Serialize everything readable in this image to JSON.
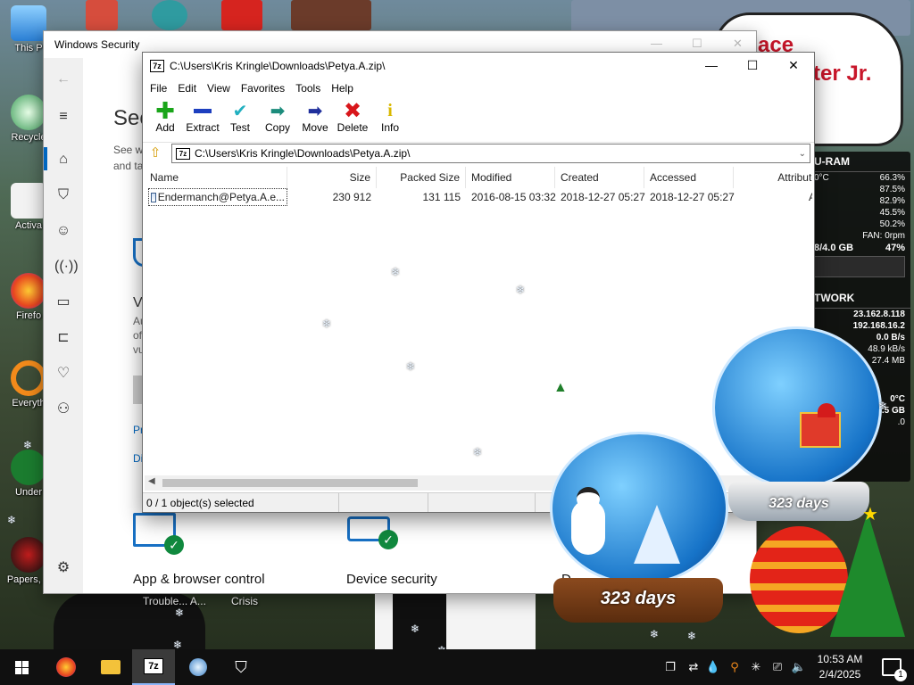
{
  "desktop": {
    "icons": [
      {
        "label": "This P"
      },
      {
        "label": "Recycle"
      },
      {
        "label": "Activa"
      },
      {
        "label": "Firefo"
      },
      {
        "label": "Everyth"
      },
      {
        "label": "Under"
      },
      {
        "label": "Papers, P"
      }
    ],
    "bottom_labels": [
      "Trouble... A...",
      "Crisis"
    ],
    "banner_text": [
      "ace",
      "ter Jr."
    ]
  },
  "gadget": {
    "cpu_ram_title": "U-RAM",
    "temp": "0°C",
    "percents": [
      "66.3%",
      "87.5%",
      "82.9%",
      "45.5%",
      "50.2%"
    ],
    "fan": "FAN: 0rpm",
    "mem_label": "8/4.0 GB",
    "mem_pct": "47%",
    "network_title": "TWORK",
    "ip1": "23.162.8.118",
    "ip2": "192.168.16.2",
    "rate1": "0.0 B/s",
    "rate2": "48.9 kB/s",
    "rate3": "27.4 MB",
    "temp2": "0°C",
    "disk": "9.5 GB",
    "disk_pct": ".0"
  },
  "winsec": {
    "title": "Windows Security",
    "heading": "Sec",
    "lines": [
      "See w",
      "and ta"
    ],
    "virus_fragments": [
      "Vi",
      "Au",
      "of",
      "vu"
    ],
    "links": [
      "Pr",
      "Di"
    ],
    "tile_app": "App & browser control",
    "tile_device": "Device security",
    "tile_d": "D"
  },
  "sevenzip": {
    "title": "C:\\Users\\Kris Kringle\\Downloads\\Petya.A.zip\\",
    "menu": [
      "File",
      "Edit",
      "View",
      "Favorites",
      "Tools",
      "Help"
    ],
    "toolbar": [
      {
        "label": "Add",
        "icon": "add-icon",
        "color": "#1aa51a"
      },
      {
        "label": "Extract",
        "icon": "extract-icon",
        "color": "#1d3fbf"
      },
      {
        "label": "Test",
        "icon": "test-icon",
        "color": "#22b0c0"
      },
      {
        "label": "Copy",
        "icon": "copy-icon",
        "color": "#1c8c7c"
      },
      {
        "label": "Move",
        "icon": "move-icon",
        "color": "#1f2f9c"
      },
      {
        "label": "Delete",
        "icon": "delete-icon",
        "color": "#d8161b"
      },
      {
        "label": "Info",
        "icon": "info-icon",
        "color": "#d9b800"
      }
    ],
    "address": "C:\\Users\\Kris Kringle\\Downloads\\Petya.A.zip\\",
    "columns": [
      "Name",
      "Size",
      "Packed Size",
      "Modified",
      "Created",
      "Accessed",
      "Attribute"
    ],
    "rows": [
      {
        "name": "Endermanch@Petya.A.e...",
        "size": "230 912",
        "packed": "131 115",
        "modified": "2016-08-15 03:32",
        "created": "2018-12-27 05:27",
        "accessed": "2018-12-27 05:27",
        "attr": "A"
      }
    ],
    "status": "0 / 1 object(s) selected"
  },
  "globes": {
    "days_label": "323 days",
    "days_label_small": "323 days"
  },
  "taskbar": {
    "time": "10:53 AM",
    "date": "2/4/2025",
    "notification_count": "1"
  }
}
